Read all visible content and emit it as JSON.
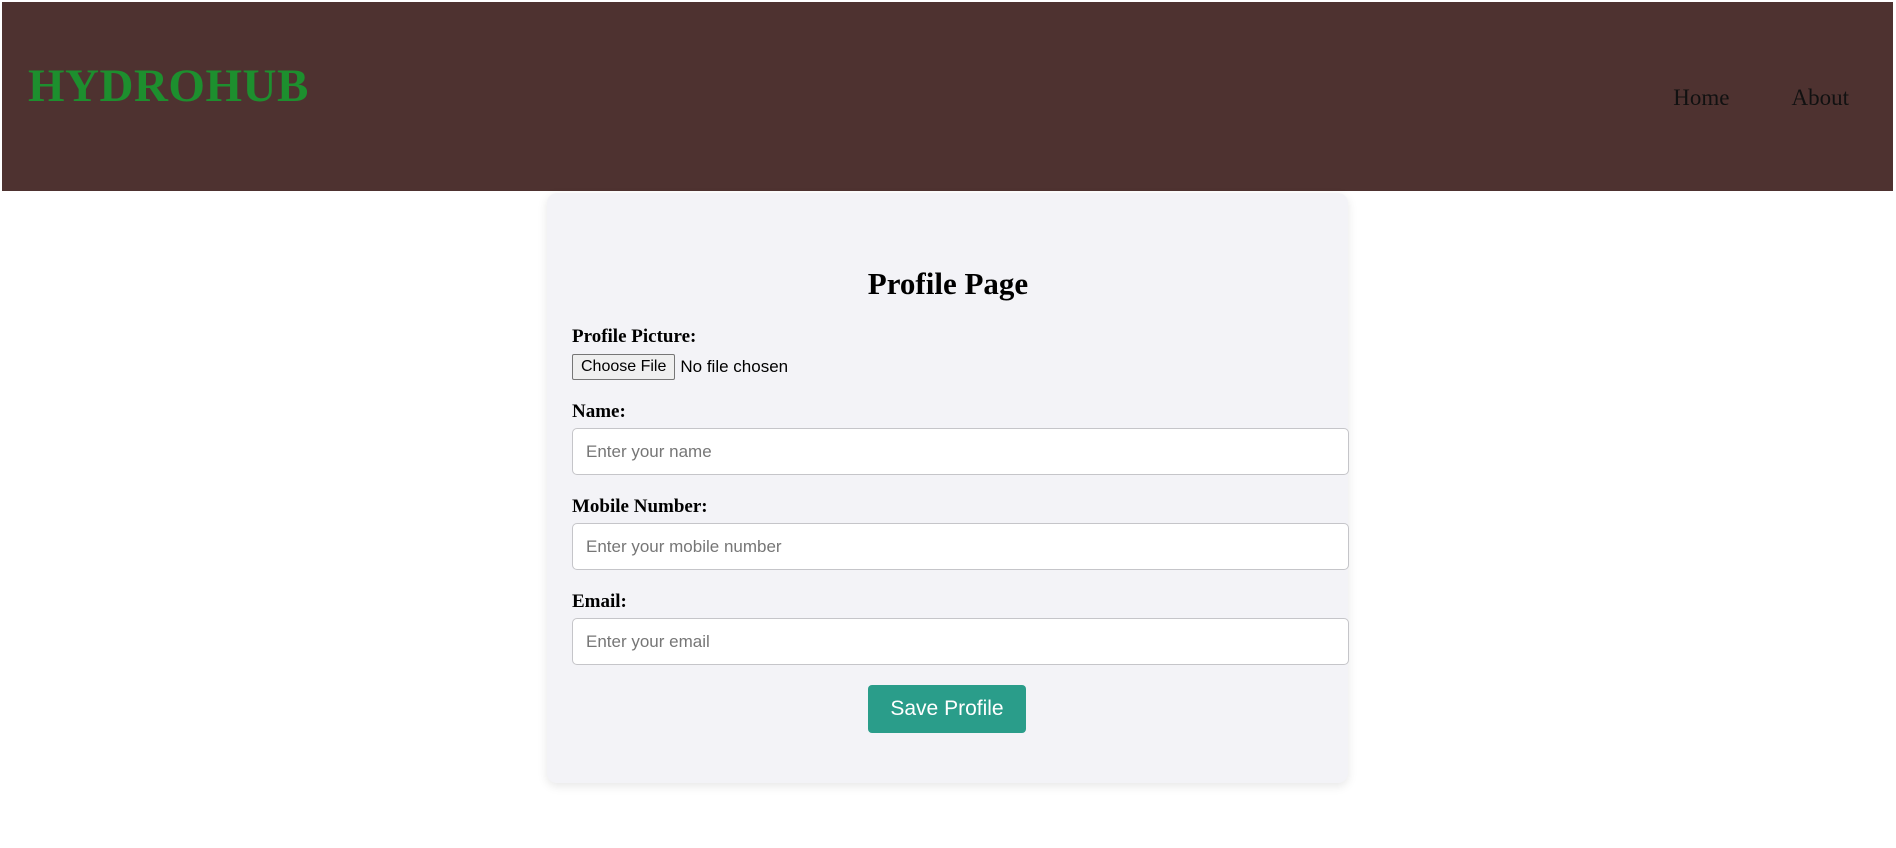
{
  "header": {
    "brand": "HYDROHUB",
    "nav": [
      {
        "label": "Home"
      },
      {
        "label": "About"
      }
    ]
  },
  "form": {
    "title": "Profile Page",
    "profile_picture": {
      "label": "Profile Picture:",
      "button_label": "Choose File",
      "status": "No file chosen"
    },
    "name": {
      "label": "Name:",
      "placeholder": "Enter your name",
      "value": ""
    },
    "mobile": {
      "label": "Mobile Number:",
      "placeholder": "Enter your mobile number",
      "value": ""
    },
    "email": {
      "label": "Email:",
      "placeholder": "Enter your email",
      "value": ""
    },
    "submit_label": "Save Profile"
  },
  "colors": {
    "header_bg": "#4e3230",
    "brand": "#1d8f2e",
    "card_bg": "#f3f3f7",
    "button_bg": "#2a9d8a"
  }
}
